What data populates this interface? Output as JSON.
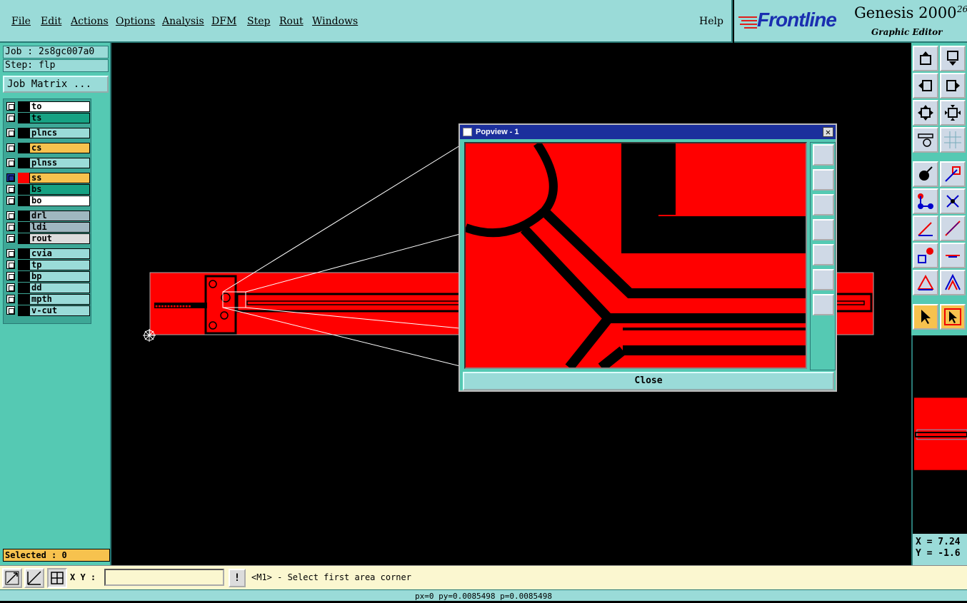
{
  "menubar": {
    "items": [
      "File",
      "Edit",
      "Actions",
      "Options",
      "Analysis",
      "DFM",
      "Step",
      "Rout",
      "Windows"
    ],
    "help": "Help"
  },
  "branding": {
    "logo": "Frontline",
    "product": "Genesis 2000",
    "version_sup": "26",
    "subtitle": "Graphic Editor"
  },
  "job": {
    "job_label": "Job : 2s8gc007a0",
    "step_label": "Step: flp",
    "job_matrix_button": "Job Matrix ..."
  },
  "layers": [
    {
      "name": "to",
      "color": "#ffffff",
      "indicator": "#000000"
    },
    {
      "name": "ts",
      "color": "#17a283",
      "indicator": "#000000"
    },
    {
      "name": "plncs",
      "color": "#9adbd8",
      "indicator": "#000000"
    },
    {
      "name": "cs",
      "color": "#f7c24e",
      "indicator": "#000000"
    },
    {
      "name": "plnss",
      "color": "#9adbd8",
      "indicator": "#000000"
    },
    {
      "name": "ss",
      "color": "#f7c24e",
      "indicator": "#ff0000",
      "active": true
    },
    {
      "name": "bs",
      "color": "#17a283",
      "indicator": "#000000"
    },
    {
      "name": "bo",
      "color": "#ffffff",
      "indicator": "#000000"
    },
    {
      "name": "drl",
      "color": "#9fb7c0",
      "indicator": "#000000"
    },
    {
      "name": "ldi",
      "color": "#9fb7c0",
      "indicator": "#000000"
    },
    {
      "name": "rout",
      "color": "#dcdcdc",
      "indicator": "#000000"
    },
    {
      "name": "cvia",
      "color": "#9adbd8",
      "indicator": "#000000"
    },
    {
      "name": "tp",
      "color": "#9adbd8",
      "indicator": "#000000"
    },
    {
      "name": "bp",
      "color": "#9adbd8",
      "indicator": "#000000"
    },
    {
      "name": "dd",
      "color": "#9adbd8",
      "indicator": "#000000"
    },
    {
      "name": "mpth",
      "color": "#9adbd8",
      "indicator": "#000000"
    },
    {
      "name": "v-cut",
      "color": "#9adbd8",
      "indicator": "#000000"
    }
  ],
  "selected_label": "Selected : 0",
  "bottombar": {
    "xy_label": "X Y :",
    "xy_value": "",
    "bang": "!",
    "prompt": "<M1> - Select first area corner"
  },
  "statusbar": "px=0 py=0.0085498 p=0.0085498",
  "coords": {
    "x": "X = 7.24",
    "y": "Y = -1.6"
  },
  "popview": {
    "title": "Popview - 1",
    "close_x": "✕",
    "close_button": "Close"
  },
  "colors": {
    "copper": "#ff0000",
    "panel": "#55c9b3",
    "menubar": "#9adbd8",
    "titlebar": "#1b2f9c"
  }
}
